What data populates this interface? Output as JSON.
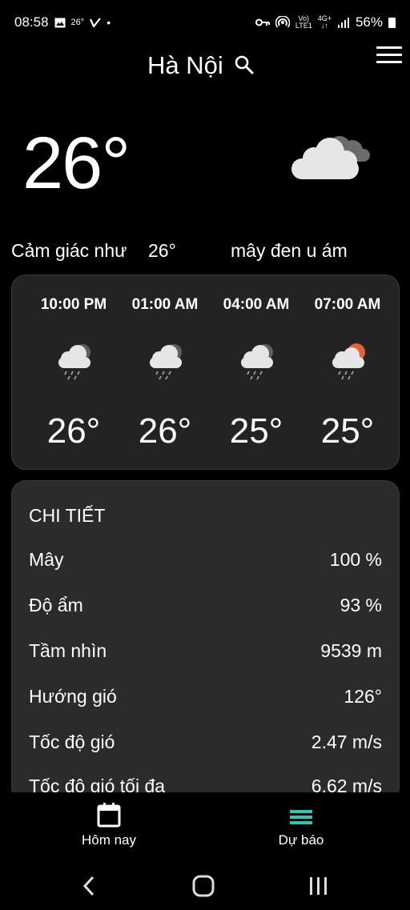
{
  "status_bar": {
    "time": "08:58",
    "temp_notice": "26°",
    "battery": "56%",
    "signal_top": "Vo)",
    "signal_bottom": "LTE1",
    "network_top": "4G+",
    "network_bottom": "↓↑"
  },
  "header": {
    "city": "Hà Nội"
  },
  "current": {
    "temperature": "26°",
    "feels_label": "Cảm giác như",
    "feels_value": "26°",
    "description": "mây đen u ám",
    "icon": "cloudy-icon"
  },
  "hourly": [
    {
      "time": "10:00 PM",
      "temp": "26°",
      "icon": "cloud-rain-icon"
    },
    {
      "time": "01:00 AM",
      "temp": "26°",
      "icon": "cloud-rain-icon"
    },
    {
      "time": "04:00 AM",
      "temp": "25°",
      "icon": "cloud-rain-icon"
    },
    {
      "time": "07:00 AM",
      "temp": "25°",
      "icon": "sun-cloud-rain-icon"
    }
  ],
  "details": {
    "title": "CHI TIẾT",
    "rows": [
      {
        "label": "Mây",
        "value": "100 %"
      },
      {
        "label": "Độ ẩm",
        "value": "93 %"
      },
      {
        "label": "Tầm nhìn",
        "value": "9539 m"
      },
      {
        "label": "Hướng gió",
        "value": "126°"
      },
      {
        "label": "Tốc độ gió",
        "value": "2.47 m/s"
      },
      {
        "label": "Tốc độ gió tối đa",
        "value": "6.62 m/s"
      }
    ]
  },
  "bottom_nav": {
    "today_label": "Hôm nay",
    "forecast_label": "Dự báo",
    "accent": "#2ec4b6"
  }
}
